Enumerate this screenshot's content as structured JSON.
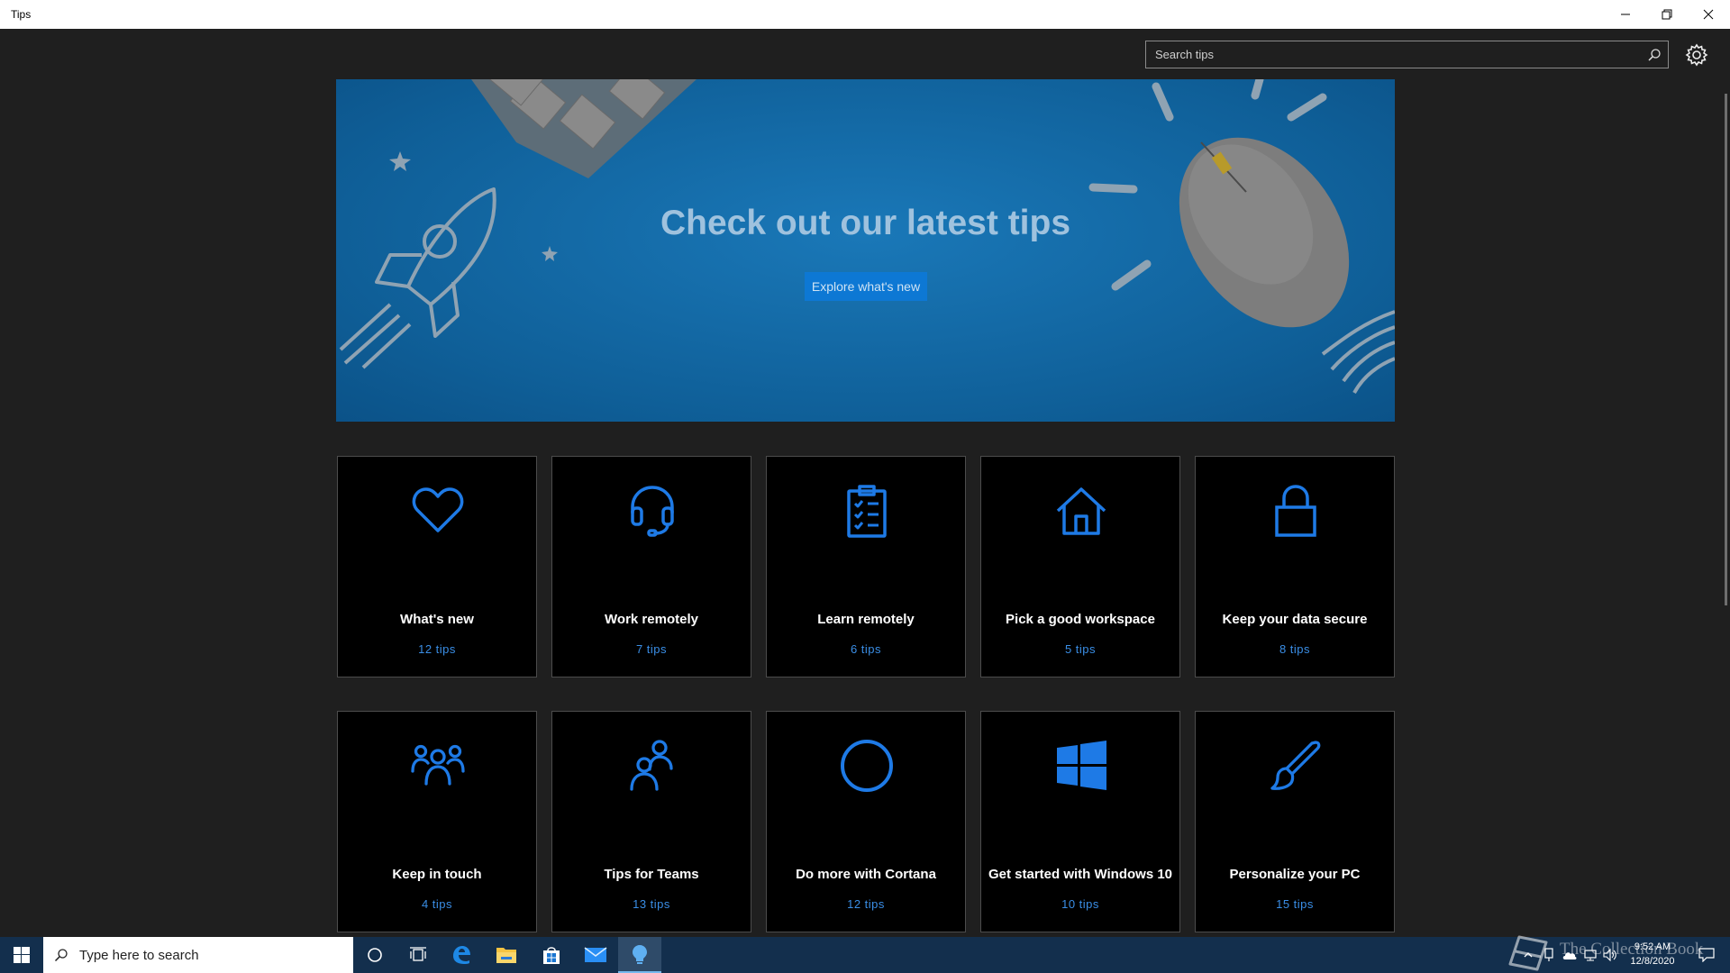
{
  "window": {
    "title": "Tips"
  },
  "search": {
    "placeholder": "Search tips"
  },
  "hero": {
    "title": "Check out our latest tips",
    "button_label": "Explore what's new",
    "colors": {
      "background": "#1070ad",
      "button": "#0d78d4"
    }
  },
  "tiles": [
    {
      "name": "What's new",
      "count": "12 tips",
      "icon": "heart-icon"
    },
    {
      "name": "Work remotely",
      "count": "7 tips",
      "icon": "headset-icon"
    },
    {
      "name": "Learn remotely",
      "count": "6 tips",
      "icon": "clipboard-checklist-icon"
    },
    {
      "name": "Pick a good workspace",
      "count": "5 tips",
      "icon": "home-icon"
    },
    {
      "name": "Keep your data secure",
      "count": "8 tips",
      "icon": "lock-icon"
    },
    {
      "name": "Keep in touch",
      "count": "4 tips",
      "icon": "people-group-icon"
    },
    {
      "name": "Tips for Teams",
      "count": "13 tips",
      "icon": "people-pair-icon"
    },
    {
      "name": "Do more with Cortana",
      "count": "12 tips",
      "icon": "cortana-circle-icon"
    },
    {
      "name": "Get started with Windows 10",
      "count": "10 tips",
      "icon": "windows-logo-icon"
    },
    {
      "name": "Personalize your PC",
      "count": "15 tips",
      "icon": "paintbrush-icon"
    }
  ],
  "accent_color": "#1e7ae6",
  "taskbar": {
    "search_placeholder": "Type here to search",
    "time": "9:52 AM",
    "date": "12/8/2020",
    "watermark": "The Collection Book",
    "pinned_apps": [
      "cortana",
      "task-view",
      "edge",
      "file-explorer",
      "store",
      "mail",
      "tips"
    ]
  }
}
